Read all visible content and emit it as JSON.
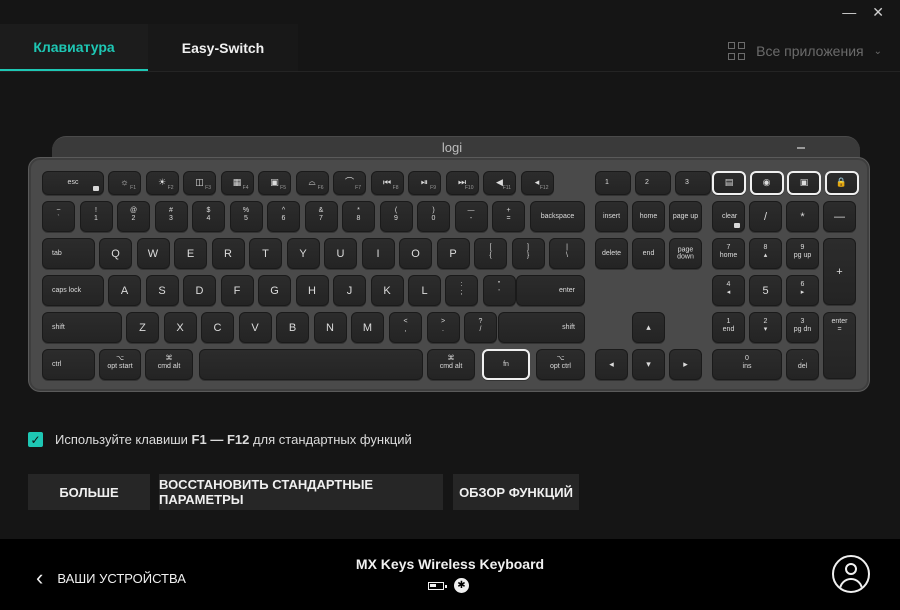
{
  "window": {
    "minimize": "—",
    "close": "✕"
  },
  "tabs": [
    {
      "label": "Клавиатура",
      "active": true
    },
    {
      "label": "Easy-Switch",
      "active": false
    }
  ],
  "apps_selector": {
    "label": "Все приложения",
    "icon": "grid-icon"
  },
  "keyboard": {
    "logo": "logi",
    "rows": {
      "fn_row": [
        "esc",
        "F1",
        "F2",
        "F3",
        "F4",
        "F5",
        "F6",
        "F7",
        "F8",
        "F9",
        "F10",
        "F11",
        "F12",
        "1",
        "2",
        "3"
      ],
      "num_row": [
        {
          "t": "~",
          "b": "`"
        },
        {
          "t": "!",
          "b": "1"
        },
        {
          "t": "@",
          "b": "2"
        },
        {
          "t": "#",
          "b": "3"
        },
        {
          "t": "$",
          "b": "4"
        },
        {
          "t": "%",
          "b": "5"
        },
        {
          "t": "^",
          "b": "6"
        },
        {
          "t": "&",
          "b": "7"
        },
        {
          "t": "*",
          "b": "8"
        },
        {
          "t": "(",
          "b": "9"
        },
        {
          "t": ")",
          "b": "0"
        },
        {
          "t": "—",
          "b": "-"
        },
        {
          "t": "+",
          "b": "="
        }
      ],
      "qwerty": [
        "Q",
        "W",
        "E",
        "R",
        "T",
        "Y",
        "U",
        "I",
        "O",
        "P"
      ],
      "qwerty_sym": [
        {
          "t": "[",
          "b": "{"
        },
        {
          "t": "]",
          "b": "}"
        },
        {
          "t": "|",
          "b": "\\"
        }
      ],
      "home_row": [
        "A",
        "S",
        "D",
        "F",
        "G",
        "H",
        "J",
        "K",
        "L"
      ],
      "home_sym": [
        {
          "t": ":",
          "b": ";"
        },
        {
          "t": "\"",
          "b": "'"
        }
      ],
      "bottom_row": [
        "Z",
        "X",
        "C",
        "V",
        "B",
        "N",
        "M"
      ],
      "bottom_sym": [
        {
          "t": "<",
          "b": ","
        },
        {
          "t": ">",
          "b": "."
        },
        {
          "t": "?",
          "b": "/"
        }
      ]
    },
    "labels": {
      "backspace": "backspace",
      "tab": "tab",
      "caps": "caps lock",
      "enter": "enter",
      "shift": "shift",
      "ctrl": "ctrl",
      "opt": "opt",
      "start": "start",
      "cmd": "cmd",
      "alt": "alt",
      "fn": "fn",
      "insert": "insert",
      "home": "home",
      "pgup": "page up",
      "delete": "delete",
      "end": "end",
      "pgdown": "page down",
      "clear": "clear",
      "np_div": "/",
      "np_mul": "*",
      "np_sub": "—",
      "np_add": "+",
      "np_enter": "enter",
      "np7": "7",
      "np7s": "home",
      "np8": "8",
      "np9": "9",
      "np9s": "pg up",
      "np4": "4",
      "np5": "5",
      "np6": "6",
      "np1": "1",
      "np1s": "end",
      "np2": "2",
      "np3": "3",
      "np3s": "pg dn",
      "np0": "0",
      "np0s": "ins",
      "npdot": ".",
      "npdots": "del",
      "opt_sym": "⌥",
      "cmd_sym": "⌘"
    }
  },
  "fkeys_option": {
    "checked": true,
    "prefix": "Используйте клавиши ",
    "range_a": "F1",
    "range_sep": " — ",
    "range_b": "F12",
    "suffix": " для стандартных функций"
  },
  "buttons": {
    "more": "Больше",
    "restore": "Восстановить стандартные параметры",
    "overview": "Обзор функций"
  },
  "footer": {
    "back_label": "ВАШИ УСТРОЙСТВА",
    "device_name": "MX Keys Wireless Keyboard",
    "bluetooth_glyph": "✱"
  },
  "colors": {
    "accent": "#1ec7b4",
    "background": "#151515",
    "footer": "#000000"
  }
}
